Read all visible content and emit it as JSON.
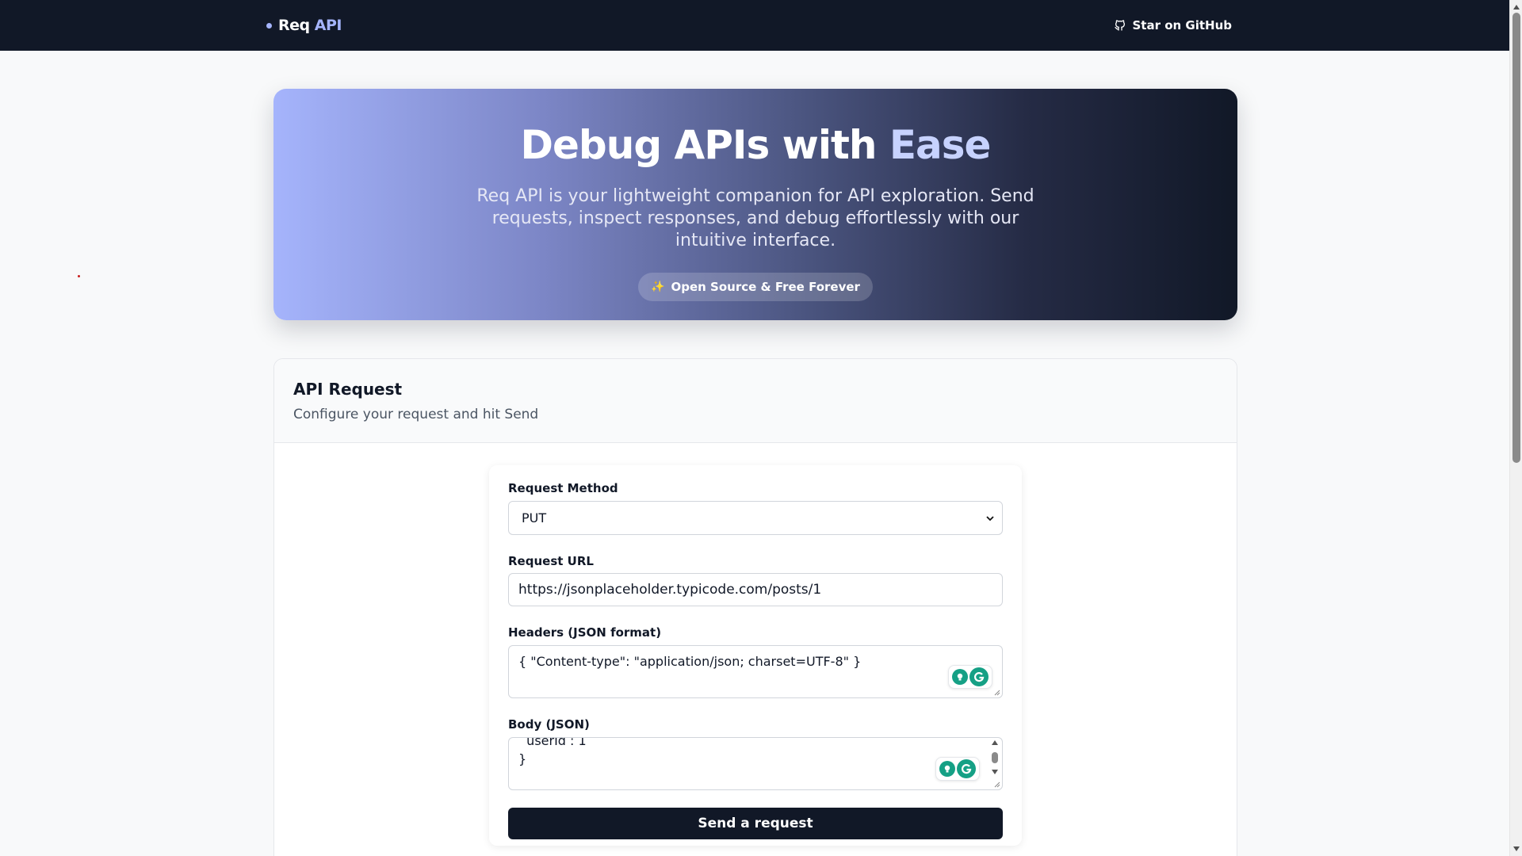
{
  "navbar": {
    "brand_main": "Req",
    "brand_accent": "API",
    "github_label": "Star on GitHub"
  },
  "hero": {
    "title_main": "Debug APIs with",
    "title_accent": "Ease",
    "description": "Req API is your lightweight companion for API exploration. Send requests, inspect responses, and debug effortlessly with our intuitive interface.",
    "badge_icon": "✨",
    "badge_label": "Open Source & Free Forever"
  },
  "request_card": {
    "title": "API Request",
    "subtitle": "Configure your request and hit Send"
  },
  "form": {
    "method_label": "Request Method",
    "method_value": "PUT",
    "url_label": "Request URL",
    "url_value": "https://jsonplaceholder.typicode.com/posts/1",
    "headers_label": "Headers (JSON format)",
    "headers_value": "{ \"Content-type\": \"application/json; charset=UTF-8\" }",
    "body_label": "Body (JSON)",
    "body_line1": "  userId : 1",
    "body_line2": "}",
    "send_label": "Send a request"
  },
  "colors": {
    "navbar_bg": "#111827",
    "accent": "#a5b4fc",
    "button_bg": "#111827",
    "grammarly": "#15a085"
  },
  "icons": [
    "github-icon",
    "sparkles-icon",
    "chevron-down-icon",
    "grammarly-bulb-icon",
    "grammarly-g-icon"
  ]
}
